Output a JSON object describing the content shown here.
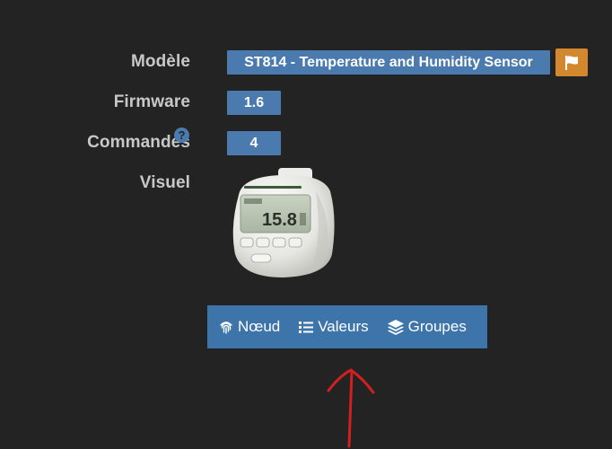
{
  "fields": {
    "model_label": "Modèle",
    "model_value": "ST814 - Temperature and Humidity Sensor",
    "firmware_label": "Firmware",
    "firmware_value": "1.6",
    "commands_label": "Commandes",
    "commands_value": "4",
    "visual_label": "Visuel"
  },
  "icons": {
    "flag": "flag-icon",
    "help": "question-circle-icon",
    "node": "fingerprint-icon",
    "values": "list-icon",
    "groups": "layers-icon"
  },
  "device": {
    "display_reading": "15.8"
  },
  "tabs": [
    {
      "label": "Nœud"
    },
    {
      "label": "Valeurs"
    },
    {
      "label": "Groupes"
    }
  ],
  "colors": {
    "badge": "#4a7aae",
    "flag_button": "#d4882e",
    "tab_bar": "#3d74aa",
    "annotation_arrow": "#d21f1f",
    "background": "#232323"
  },
  "help_glyph": "?"
}
